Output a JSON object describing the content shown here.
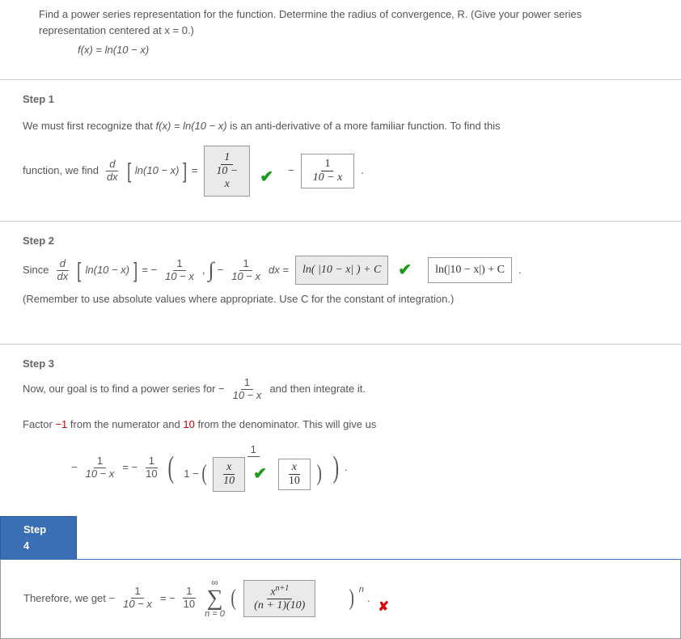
{
  "instructions": "Find a power series representation for the function. Determine the radius of convergence, R. (Give your power series representation centered at x = 0.)",
  "function_lhs": "f(x)",
  "function_eq": " = ",
  "function_rhs": "ln(10 − x)",
  "step1": {
    "title": "Step 1",
    "text_a": "We must first recognize that ",
    "text_a2": "f(x) = ln(10 − x)",
    "text_a3": " is an anti-derivative of a more familiar function. To find this",
    "text_b": "function, we find ",
    "deriv_d": "d",
    "deriv_dx": "dx",
    "ln_expr": "ln(10 − x)",
    "eq": " = ",
    "answer_num": "1",
    "answer_den_a": "10 −",
    "answer_den_b": "x",
    "correct_num": "1",
    "correct_den": "10 − x",
    "period": "."
  },
  "step2": {
    "title": "Step 2",
    "since": "Since ",
    "deriv_d": "d",
    "deriv_dx": "dx",
    "ln_expr": "ln(10 − x)",
    "eq1": " = − ",
    "frac1_num": "1",
    "frac1_den": "10 − x",
    "comma": ", ",
    "int_expr_pre": " − ",
    "int_frac_num": "1",
    "int_frac_den": "10 − x",
    "dx_eq": " dx = ",
    "answer": "ln( |10 − x| ) + C",
    "correct": "ln(|10 − x|) + C",
    "period": ".",
    "note": "(Remember to use absolute values where appropriate. Use C for the constant of integration.)"
  },
  "step3": {
    "title": "Step 3",
    "line1_a": "Now, our goal is to find a power series for − ",
    "line1_num": "1",
    "line1_den": "10 − x",
    "line1_b": " and then integrate it.",
    "line2_a": "Factor ",
    "line2_m1": "−1",
    "line2_b": " from the numerator and ",
    "line2_10": "10",
    "line2_c": " from the denominator. This will give us",
    "lhs_num": "1",
    "lhs_den": "10 − x",
    "eq": " = − ",
    "one_over_10": "1",
    "ten": "10",
    "big_num": "1",
    "one_minus": "1 − ",
    "answer_num": "x",
    "answer_den": "10",
    "correct_num": "x",
    "correct_den": "10",
    "period": "."
  },
  "step4": {
    "title": "Step 4",
    "text_a": "Therefore, we get − ",
    "lhs_num": "1",
    "lhs_den": "10 − x",
    "eq": " = − ",
    "one": "1",
    "ten": "10",
    "sum_top": "∞",
    "sum_bottom": "n = 0",
    "answer_num": "xⁿ⁺¹",
    "answer_den": "(n + 1)(10)",
    "blank_sup": "n",
    "period": "."
  }
}
